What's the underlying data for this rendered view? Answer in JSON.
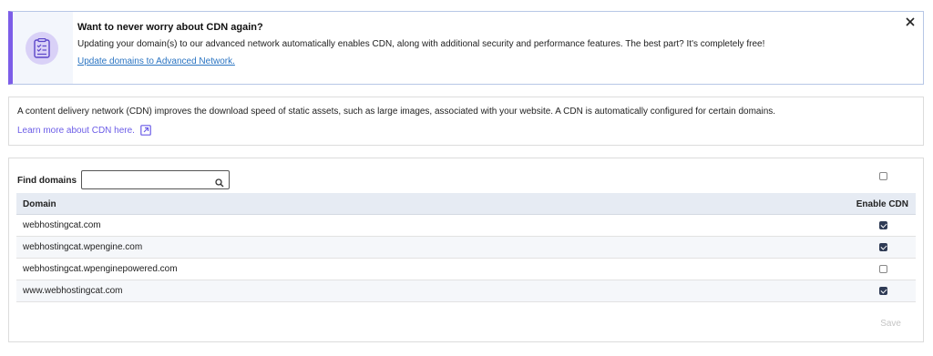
{
  "banner": {
    "title": "Want to never worry about CDN again?",
    "text": "Updating your domain(s) to our advanced network automatically enables CDN, along with additional security and performance features. The best part? It's completely free!",
    "link": "Update domains to Advanced Network.",
    "icon": "checklist-icon",
    "close_icon": "close-icon",
    "accent_color": "#7c5de8"
  },
  "info": {
    "text": "A content delivery network (CDN) improves the download speed of static assets, such as large images, associated with your website. A CDN is automatically configured for certain domains.",
    "link": "Learn more about CDN here.",
    "link_icon": "external-link-icon",
    "link_color": "#6b5ce7"
  },
  "domains": {
    "find_label": "Find domains",
    "search_placeholder": "",
    "search_value": "",
    "search_icon": "search-icon",
    "columns": [
      "Domain",
      "Enable CDN"
    ],
    "rows": [
      {
        "domain": "webhostingcat.com",
        "cdn_enabled": true
      },
      {
        "domain": "webhostingcat.wpengine.com",
        "cdn_enabled": true
      },
      {
        "domain": "webhostingcat.wpenginepowered.com",
        "cdn_enabled": false
      },
      {
        "domain": "www.webhostingcat.com",
        "cdn_enabled": true
      }
    ],
    "select_all_checked": false,
    "save_label": "Save"
  }
}
